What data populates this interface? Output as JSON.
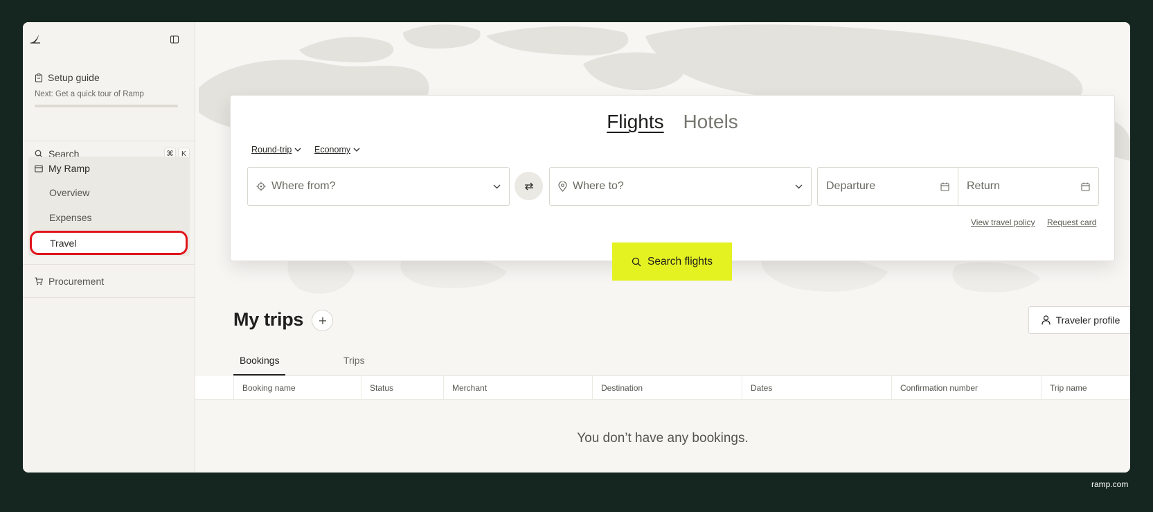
{
  "sidebar": {
    "setup_title": "Setup guide",
    "setup_next": "Next: Get a quick tour of Ramp",
    "setup_progress": 0,
    "search_label": "Search",
    "shortcut": [
      "⌘",
      "K"
    ],
    "my_ramp": "My Ramp",
    "overview": "Overview",
    "expenses": "Expenses",
    "travel": "Travel",
    "procurement": "Procurement"
  },
  "booking": {
    "tab_flights": "Flights",
    "tab_hotels": "Hotels",
    "trip_type": "Round-trip",
    "cabin": "Economy",
    "from_placeholder": "Where from?",
    "to_placeholder": "Where to?",
    "departure": "Departure",
    "return": "Return",
    "view_policy": "View travel policy",
    "request_card": "Request card",
    "search_button": "Search flights"
  },
  "trips": {
    "title": "My trips",
    "traveler_profile": "Traveler profile",
    "tabs": [
      "Bookings",
      "Trips"
    ],
    "columns": [
      "Booking name",
      "Status",
      "Merchant",
      "Destination",
      "Dates",
      "Confirmation number",
      "Trip name"
    ],
    "empty_message": "You don’t have any bookings."
  },
  "footer": {
    "brand": "ramp.com"
  },
  "colors": {
    "accent": "#e4f222",
    "highlight": "#e0141b",
    "background": "#14261f"
  }
}
